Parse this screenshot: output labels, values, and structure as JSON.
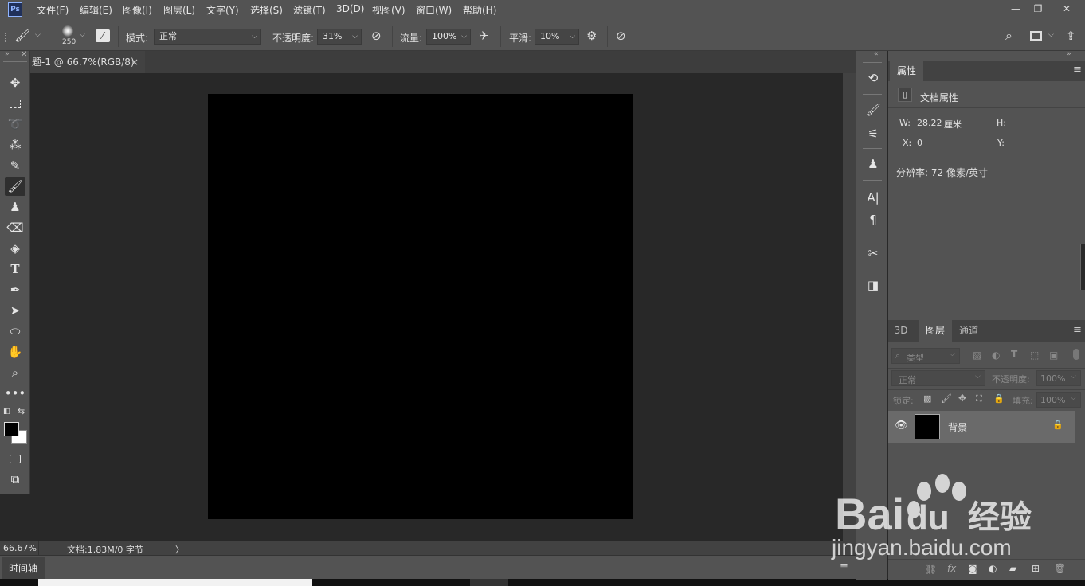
{
  "app": {
    "logo": "Ps"
  },
  "menu": [
    "文件(F)",
    "编辑(E)",
    "图像(I)",
    "图层(L)",
    "文字(Y)",
    "选择(S)",
    "滤镜(T)",
    "3D(D)",
    "视图(V)",
    "窗口(W)",
    "帮助(H)"
  ],
  "window_controls": {
    "minimize": "—",
    "restore": "❐",
    "close": "✕"
  },
  "options": {
    "brush_size": "250",
    "mode_label": "模式:",
    "mode_value": "正常",
    "opacity_label": "不透明度:",
    "opacity_value": "31%",
    "flow_label": "流量:",
    "flow_value": "100%",
    "smoothing_label": "平滑:",
    "smoothing_value": "10%"
  },
  "document": {
    "tab_title": "题-1 @ 66.7%(RGB/8)",
    "tab_close": "×",
    "canvas_color": "#000000"
  },
  "status": {
    "zoom": "66.67%",
    "doc_info": "文档:1.83M/0 字节",
    "arrow": "〉"
  },
  "timeline": {
    "tab": "时间轴"
  },
  "properties": {
    "tab": "属性",
    "section_title": "文档属性",
    "w_label": "W:",
    "w_value": "28.22",
    "w_unit": "厘米",
    "h_label": "H:",
    "x_label": "X:",
    "x_value": "0",
    "y_label": "Y:",
    "resolution": "分辨率: 72 像素/英寸"
  },
  "layers": {
    "tabs": [
      "3D",
      "图层",
      "通道"
    ],
    "active_tab": "图层",
    "filter_kind": "类型",
    "blend_mode": "正常",
    "opacity_label": "不透明度:",
    "opacity_value": "100%",
    "lock_label": "锁定:",
    "fill_label": "填充:",
    "fill_value": "100%",
    "items": [
      {
        "name": "背景",
        "locked": true,
        "visible": true
      }
    ]
  },
  "watermark": {
    "brand": "Bai",
    "brand2": "du",
    "suffix": "经验",
    "url": "jingyan.baidu.com"
  },
  "colors": {
    "ui_panel": "#535353",
    "ui_dark": "#424242",
    "workspace": "#282828",
    "foreground": "#000000",
    "background": "#ffffff"
  }
}
